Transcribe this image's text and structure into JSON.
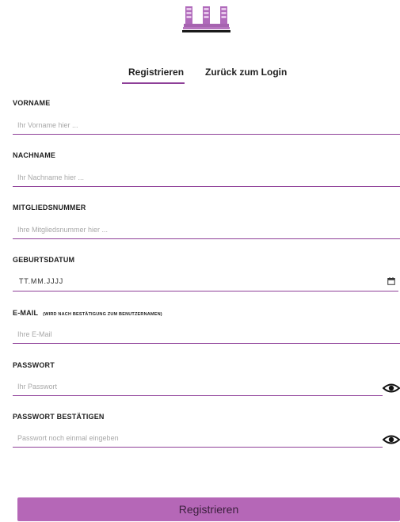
{
  "tabs": {
    "register": "Registrieren",
    "back_to_login": "Zurück zum Login"
  },
  "fields": {
    "first_name": {
      "label": "VORNAME",
      "placeholder": "Ihr Vorname hier ..."
    },
    "last_name": {
      "label": "NACHNAME",
      "placeholder": "Ihr Nachname hier ..."
    },
    "member_number": {
      "label": "MITGLIEDSNUMMER",
      "placeholder": "Ihre Mitgliedsnummer hier ..."
    },
    "birth_date": {
      "label": "GEBURTSDATUM",
      "placeholder": "TT.MM.JJJJ"
    },
    "email": {
      "label": "E-MAIL",
      "note": "(WIRD NACH BESTÄTIGUNG ZUM BENUTZERNAMEN)",
      "placeholder": "Ihre E-Mail"
    },
    "password": {
      "label": "PASSWORT",
      "placeholder": "Ihr Passwort"
    },
    "password_confirm": {
      "label": "PASSWORT BESTÄTIGEN",
      "placeholder": "Passwort noch einmal eingeben"
    }
  },
  "submit_label": "Registrieren",
  "colors": {
    "accent": "#8e3f98",
    "button": "#b567b7",
    "logo": "#a663b0"
  },
  "icons": {
    "date_picker": "calendar-icon",
    "show_password": "eye-icon"
  }
}
